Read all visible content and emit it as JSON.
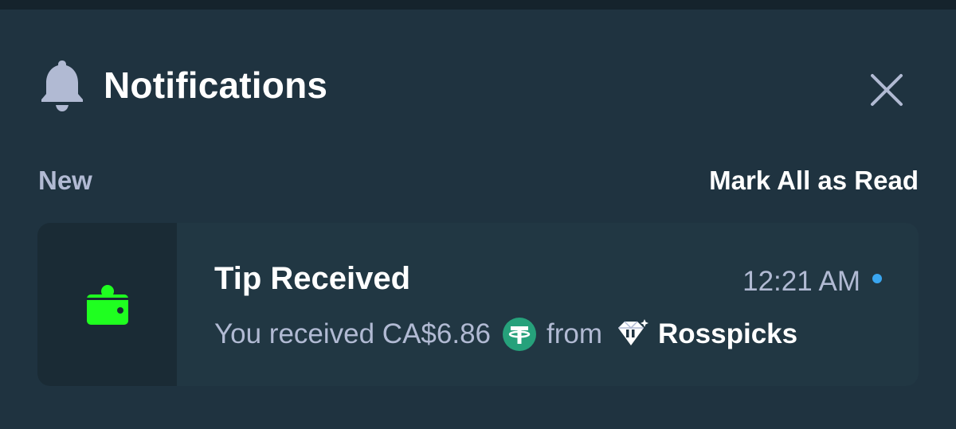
{
  "header": {
    "title": "Notifications",
    "bell_icon": "bell-icon",
    "close_icon": "close-icon"
  },
  "section": {
    "label": "New",
    "mark_all_label": "Mark All as Read"
  },
  "notification": {
    "icon": "wallet-icon",
    "title": "Tip Received",
    "time": "12:21 AM",
    "unread": true,
    "message_prefix": "You received CA$6.86",
    "currency_icon": "tether-icon",
    "message_from": "from",
    "user_badge_icon": "vip-diamond-icon",
    "username": "Rosspicks"
  },
  "colors": {
    "background": "#1f3340",
    "card": "#213743",
    "card_icon_bg": "#1a2b35",
    "muted_text": "#b1bad3",
    "wallet_green": "#1fff20",
    "tether_green": "#26a17b",
    "unread_dot": "#3aa6f0"
  }
}
